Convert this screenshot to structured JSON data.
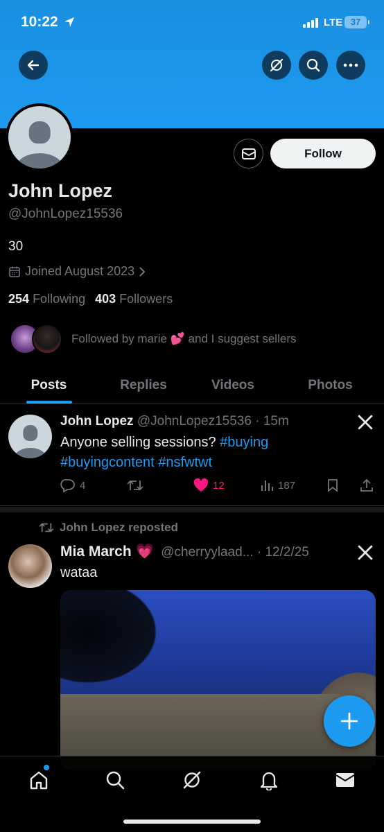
{
  "status_bar": {
    "time": "10:22",
    "network": "LTE",
    "battery": "37"
  },
  "profile": {
    "name": "John Lopez",
    "handle": "@JohnLopez15536",
    "bio": "30",
    "joined": "Joined August 2023",
    "following_count": "254",
    "following_label": "Following",
    "followers_count": "403",
    "followers_label": "Followers",
    "followed_by": "Followed by marie 💕 and I suggest sellers",
    "follow_label": "Follow"
  },
  "tabs": [
    {
      "label": "Posts",
      "active": true
    },
    {
      "label": "Replies",
      "active": false
    },
    {
      "label": "Videos",
      "active": false
    },
    {
      "label": "Photos",
      "active": false
    }
  ],
  "posts": [
    {
      "author": "John Lopez",
      "meta": "@JohnLopez15536 · 15m",
      "text_prefix": "Anyone selling sessions?",
      "hashtag1": "#buying",
      "hashtag2": "#buyingcontent",
      "hashtag3": "#nsfwtwt",
      "replies": "4",
      "likes": "12",
      "views": "187",
      "liked": true
    },
    {
      "repost_label": "John Lopez reposted",
      "author": "Mia March 💗",
      "meta": "@cherryylaad... · 12/2/25",
      "text": "wataa"
    }
  ],
  "colors": {
    "accent": "#1d9bf0",
    "like": "#f91880",
    "banner": "#1d9bf0"
  },
  "icons": [
    "back-arrow-icon",
    "grok-icon",
    "search-icon",
    "more-icon",
    "mail-icon",
    "calendar-icon",
    "chevron-right-icon",
    "x-logo-icon",
    "reply-icon",
    "repost-icon",
    "heart-icon",
    "views-icon",
    "bookmark-icon",
    "share-icon",
    "plus-icon",
    "home-icon",
    "bell-icon",
    "envelope-icon"
  ]
}
